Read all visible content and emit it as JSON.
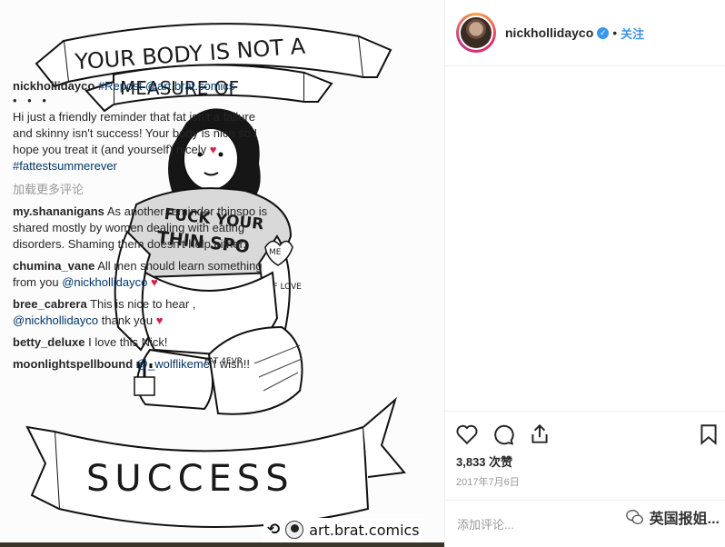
{
  "artwork": {
    "banner_top_line1": "YOUR BODY IS NOT A",
    "banner_top_line2": "MEASURE OF",
    "banner_bottom": "SUCCESS",
    "shirt_line1": "FUCK YOUR",
    "shirt_line2": "THIN SPO",
    "heart_label": "ME",
    "arm_label": "SELF LOVE",
    "thigh_label": "FAT 4EVR",
    "credit_handle": "art.brat.comics"
  },
  "header": {
    "username": "nickhollidayco",
    "separator": "•",
    "follow_label": "关注"
  },
  "caption": {
    "username": "nickhollidayco",
    "tags_inline": "#Repost @art.brat.comics",
    "dots": "• • •",
    "body": "Hi just a friendly reminder that fat isn't a failure and skinny isn't success! Your body is nice so I hope you treat it (and yourself) nicely",
    "hashtag": "#fattestsummerever"
  },
  "load_more": "加载更多评论",
  "comments": [
    {
      "user": "my.shananigans",
      "text": "As another reminder thinspo is shared mostly by women dealing with eating disorders. Shaming them doesn't help either."
    },
    {
      "user": "chumina_vane",
      "text": "All men should learn something from you",
      "mention": "@nickhollidayco"
    },
    {
      "user": "bree_cabrera",
      "text": "This is nice to hear ,",
      "mention": "@nickhollidayco",
      "tail": "thank you"
    },
    {
      "user": "betty_deluxe",
      "text": "I love this Nick!"
    },
    {
      "user": "moonlightspellbound",
      "mention": "@_wolflikeme",
      "text": "I wish!!"
    }
  ],
  "likes": "3,833 次赞",
  "date": "2017年7月6日",
  "add_comment_placeholder": "添加评论...",
  "watermark": "英国报姐...",
  "icons": [
    "heart-icon",
    "comment-icon",
    "share-icon",
    "bookmark-icon",
    "verified-badge-icon",
    "repost-icon",
    "wechat-icon"
  ],
  "colors": {
    "link": "#003569",
    "follow": "#3897f0",
    "muted": "#999999",
    "heart": "#d62246"
  }
}
